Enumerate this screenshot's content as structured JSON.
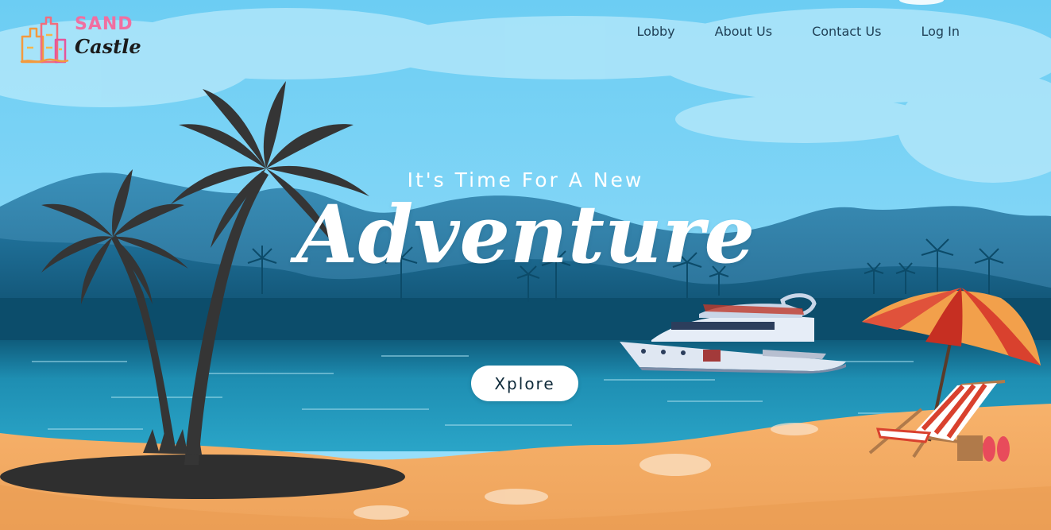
{
  "brand": {
    "name_top": "SAND",
    "name_bottom": "Castle",
    "logo_icon": "sandcastle-icon"
  },
  "nav": {
    "items": [
      {
        "label": "Lobby"
      },
      {
        "label": "About Us"
      },
      {
        "label": "Contact Us"
      },
      {
        "label": "Log In"
      }
    ]
  },
  "hero": {
    "tagline": "It's Time For A New",
    "headline": "Adventure",
    "cta_label": "Xplore"
  },
  "colors": {
    "sky": "#7fd3f5",
    "sea": "#1b8fb0",
    "sand": "#f6b26b",
    "mountain": "#2d7fa6",
    "palm": "#333333",
    "brand_pink": "#f06fa0",
    "nav_text": "#1f3f55"
  }
}
